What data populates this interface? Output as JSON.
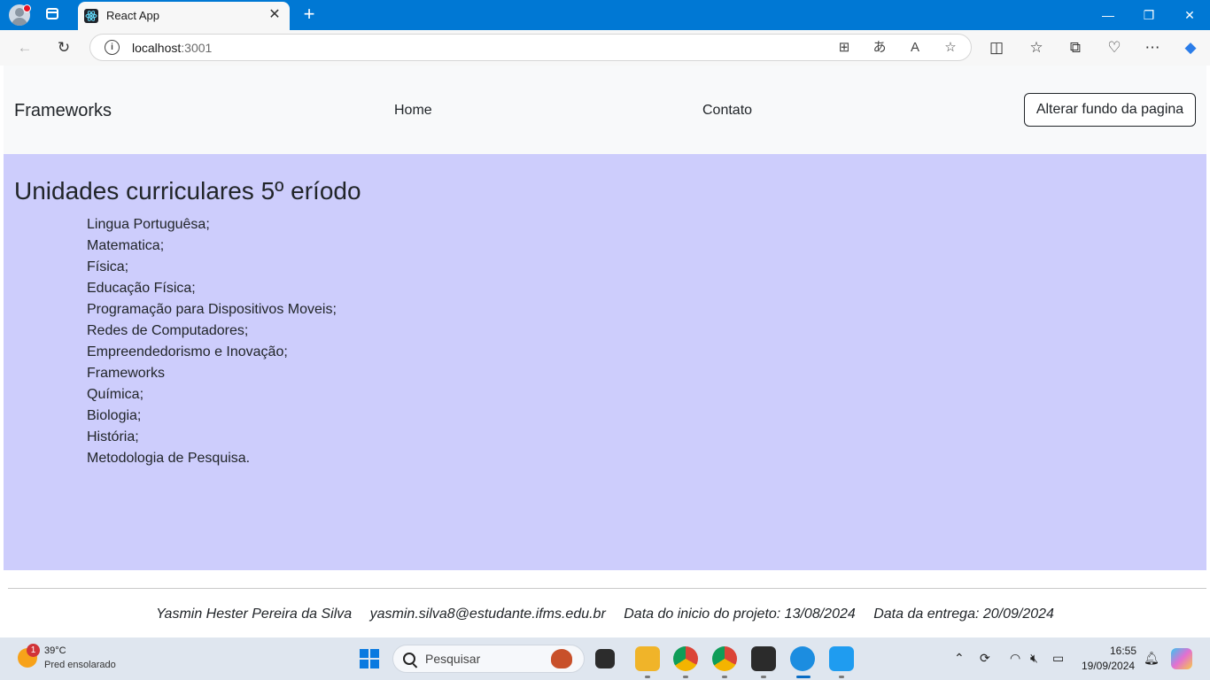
{
  "browser": {
    "tab_title": "React App",
    "new_tab_symbol": "+",
    "tab_close_symbol": "✕",
    "url_host": "localhost",
    "url_port": ":3001",
    "window_controls": {
      "minimize": "—",
      "restore": "❐",
      "close": "✕"
    }
  },
  "navbar": {
    "brand": "Frameworks",
    "links": [
      "Home",
      "Contato"
    ],
    "button": "Alterar fundo da pagina"
  },
  "content": {
    "heading": "Unidades curriculares 5º eríodo",
    "subjects": [
      "Lingua Portuguêsa;",
      "Matematica;",
      "Física;",
      "Educação Física;",
      "Programação para Dispositivos Moveis;",
      "Redes de Computadores;",
      "Empreendedorismo e Inovação;",
      "Frameworks",
      "Química;",
      "Biologia;",
      "História;",
      "Metodologia de Pesquisa."
    ],
    "background_color": "#cdcdfc"
  },
  "footer": {
    "author": "Yasmin Hester Pereira da Silva",
    "email": "yasmin.silva8@estudante.ifms.edu.br",
    "start_date": "Data do inicio do projeto: 13/08/2024",
    "delivery_date": "Data da entrega: 20/09/2024"
  },
  "taskbar": {
    "weather_badge": "1",
    "weather_temp": "39°C",
    "weather_desc": "Pred ensolarado",
    "search_placeholder": "Pesquisar",
    "clock_time": "16:55",
    "clock_date": "19/09/2024"
  }
}
